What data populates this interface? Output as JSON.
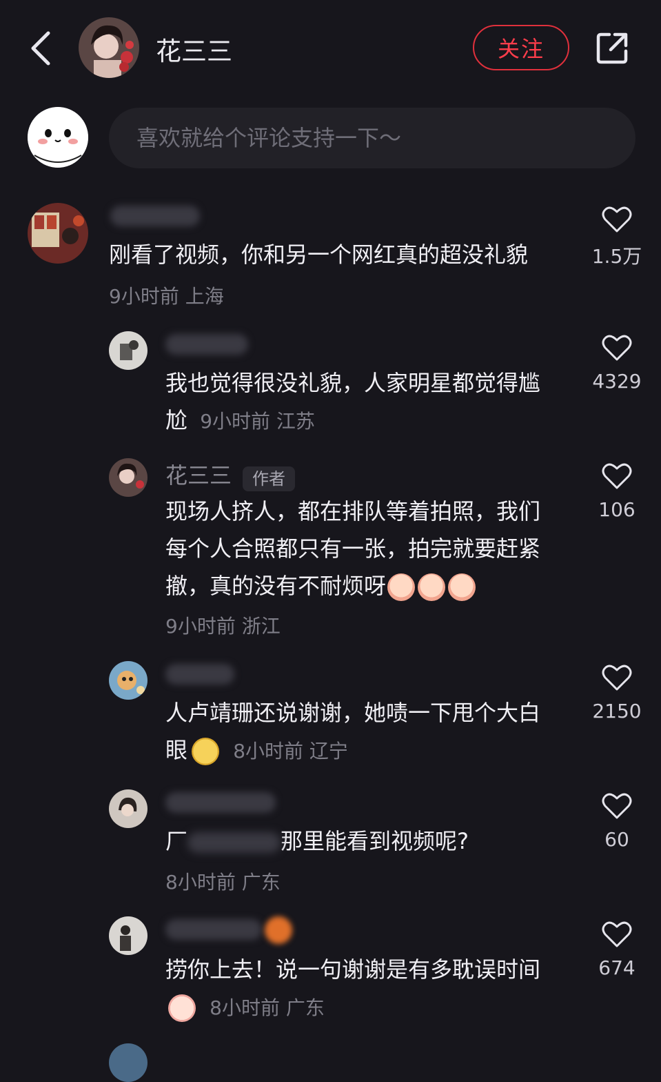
{
  "header": {
    "back_icon": "chevron-left-icon",
    "username": "花三三",
    "follow_label": "关注",
    "share_icon": "share-out-icon"
  },
  "comment_input": {
    "placeholder": "喜欢就给个评论支持一下～"
  },
  "colors": {
    "background": "#17161c",
    "accent": "#ff3d4b",
    "text": "#f0eff4",
    "meta": "#7f7e88"
  },
  "comments": [
    {
      "text": "刚看了视频，你和另一个网红真的超没礼貌",
      "meta": "9小时前 上海",
      "likes": "1.5万"
    },
    {
      "text": "我也觉得很没礼貌，人家明星都觉得尴尬",
      "meta": "9小时前 江苏",
      "likes": "4329"
    },
    {
      "name": "花三三",
      "tag": "作者",
      "text": "现场人挤人，都在排队等着拍照，我们每个人合照都只有一张，拍完就要赶紧撤，真的没有不耐烦呀",
      "meta": "9小时前 浙江",
      "likes": "106"
    },
    {
      "text": "人卢靖珊还说谢谢，她啧一下甩个大白眼",
      "meta": "8小时前 辽宁",
      "likes": "2150"
    },
    {
      "text_prefix": "厂",
      "text": "那里能看到视频呢?",
      "meta": "8小时前 广东",
      "likes": "60"
    },
    {
      "text": "捞你上去！说一句谢谢是有多耽误时间",
      "meta": "8小时前 广东",
      "likes": "674"
    }
  ]
}
